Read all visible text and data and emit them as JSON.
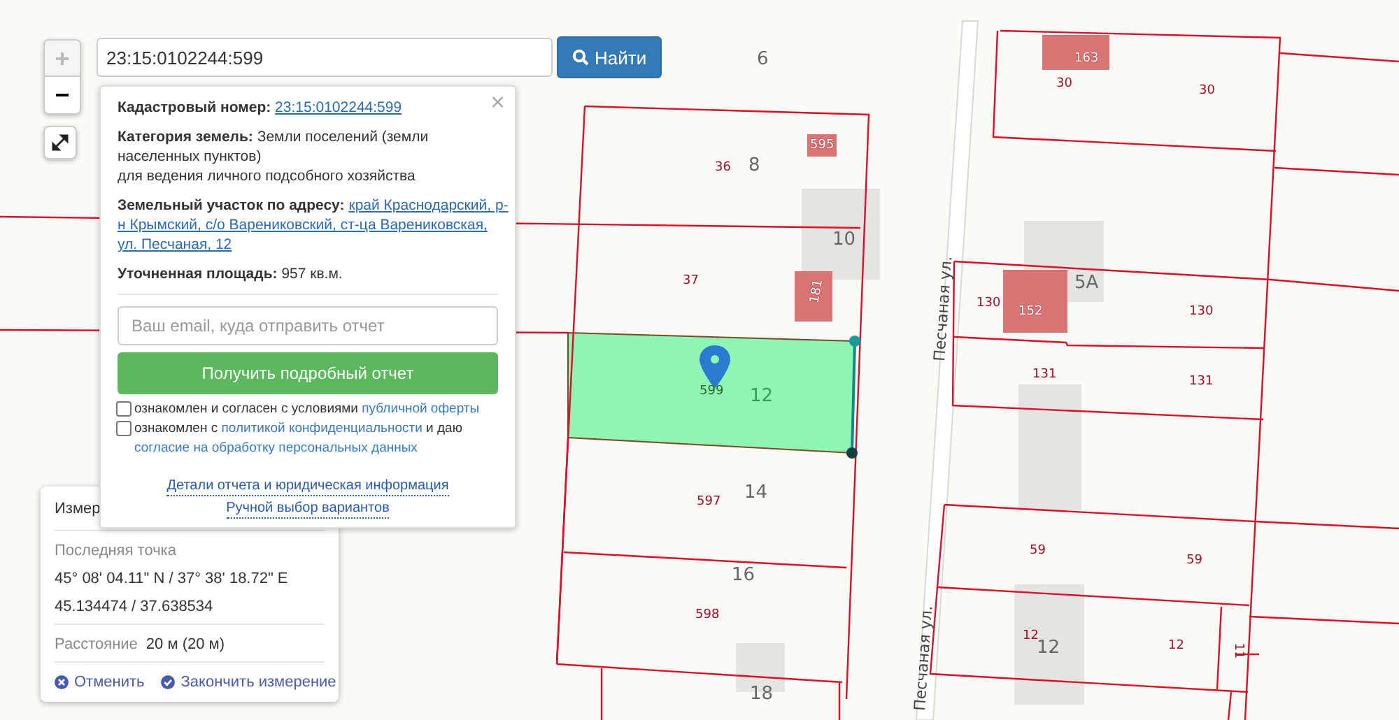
{
  "zoom_control": {
    "zoom_in": "+",
    "zoom_out": "−"
  },
  "search": {
    "value": "23:15:0102244:599",
    "button": "Найти"
  },
  "popup": {
    "close": "×",
    "fields": [
      {
        "label": "Кадастровый номер:",
        "value": "23:15:0102244:599",
        "kind": "link"
      },
      {
        "label": "Категория земель:",
        "value": "Земли поселений (земли населенных пунктов)",
        "kind": "text",
        "note": "для ведения личного подсобного хозяйства"
      },
      {
        "label": "Земельный участок по адресу:",
        "value_lines": [
          "край Краснодарский, р-",
          "н Крымский, с/о Варениковский, ст-ца Варениковская,",
          "ул. Песчаная, 12"
        ],
        "kind": "link_lines"
      },
      {
        "label": "Уточненная площадь:",
        "value": "957 кв.м.",
        "kind": "text"
      }
    ],
    "email": {
      "placeholder": "Ваш email, куда отправить отчет"
    },
    "report_button": "Получить подробный отчет",
    "consents": [
      {
        "checked": false,
        "parts": [
          {
            "text": "ознакомлен и согласен с условиями ",
            "kind": "text"
          },
          {
            "text": "публичной оферты",
            "kind": "link"
          }
        ]
      },
      {
        "checked": false,
        "parts": [
          {
            "text": "ознакомлен с ",
            "kind": "text"
          },
          {
            "text": "политикой конфиденциальности",
            "kind": "link"
          },
          {
            "text": " и даю ",
            "kind": "text"
          },
          {
            "text": "согласие на обработку персональных данных",
            "kind": "link"
          }
        ]
      }
    ],
    "links": [
      "Детали отчета и юридическая информация",
      "Ручной выбор вариантов"
    ]
  },
  "measure": {
    "title": "Измер",
    "last_point_label": "Последняя точка",
    "dms": "45° 08' 04.11\" N / 37° 38' 18.72\" E",
    "decimal": "45.134474 / 37.638534",
    "distance_label": "Расстояние",
    "distance": "20 м (20 м)",
    "cancel": "Отменить",
    "finish": "Закончить измерение"
  },
  "map": {
    "labels": [
      {
        "text": "6",
        "kind": "house"
      },
      {
        "text": "8",
        "kind": "house"
      },
      {
        "text": "36",
        "kind": "parcel"
      },
      {
        "text": "595",
        "kind": "building"
      },
      {
        "text": "10",
        "kind": "house"
      },
      {
        "text": "37",
        "kind": "parcel"
      },
      {
        "text": "181",
        "kind": "building"
      },
      {
        "text": "599",
        "kind": "selected"
      },
      {
        "text": "12",
        "kind": "house_selected"
      },
      {
        "text": "597",
        "kind": "parcel"
      },
      {
        "text": "14",
        "kind": "house"
      },
      {
        "text": "16",
        "kind": "house"
      },
      {
        "text": "598",
        "kind": "parcel"
      },
      {
        "text": "18",
        "kind": "house"
      },
      {
        "text": "Песчаная ул.",
        "kind": "street"
      },
      {
        "text": "Песчаная ул.",
        "kind": "street"
      },
      {
        "text": "163",
        "kind": "building"
      },
      {
        "text": "30",
        "kind": "parcel"
      },
      {
        "text": "30",
        "kind": "parcel"
      },
      {
        "text": "5А",
        "kind": "house"
      },
      {
        "text": "130",
        "kind": "parcel"
      },
      {
        "text": "152",
        "kind": "building"
      },
      {
        "text": "130",
        "kind": "parcel"
      },
      {
        "text": "131",
        "kind": "parcel"
      },
      {
        "text": "131",
        "kind": "parcel"
      },
      {
        "text": "59",
        "kind": "parcel"
      },
      {
        "text": "59",
        "kind": "parcel"
      },
      {
        "text": "12",
        "kind": "parcel"
      },
      {
        "text": "12",
        "kind": "house"
      },
      {
        "text": "12",
        "kind": "parcel"
      },
      {
        "text": "11",
        "kind": "parcel_rot"
      }
    ]
  }
}
